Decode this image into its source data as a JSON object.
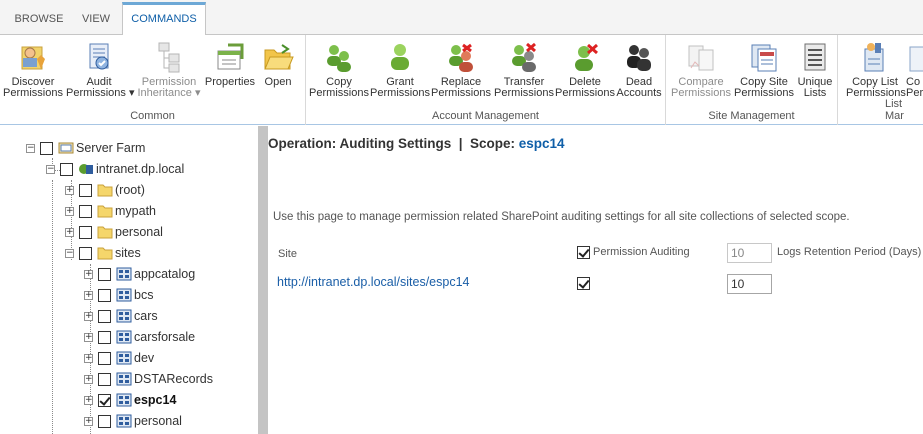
{
  "tabs": [
    {
      "label": "BROWSE"
    },
    {
      "label": "VIEW"
    },
    {
      "label": "COMMANDS"
    }
  ],
  "ribbon": {
    "groups": [
      {
        "label": "Common",
        "buttons": [
          {
            "l1": "Discover",
            "l2": "Permissions"
          },
          {
            "l1": "Audit",
            "l2": "Permissions ▾"
          },
          {
            "l1": "Permission",
            "l2": "Inheritance ▾"
          },
          {
            "l1": "Properties",
            "l2": ""
          },
          {
            "l1": "Open",
            "l2": ""
          }
        ]
      },
      {
        "label": "Account Management",
        "buttons": [
          {
            "l1": "Copy",
            "l2": "Permissions"
          },
          {
            "l1": "Grant",
            "l2": "Permissions"
          },
          {
            "l1": "Replace",
            "l2": "Permissions"
          },
          {
            "l1": "Transfer",
            "l2": "Permissions"
          },
          {
            "l1": "Delete",
            "l2": "Permissions"
          },
          {
            "l1": "Dead",
            "l2": "Accounts"
          }
        ]
      },
      {
        "label": "Site Management",
        "buttons": [
          {
            "l1": "Compare",
            "l2": "Permissions"
          },
          {
            "l1": "Copy Site",
            "l2": "Permissions"
          },
          {
            "l1": "Unique",
            "l2": "Lists"
          }
        ]
      },
      {
        "label": "List Mar",
        "buttons": [
          {
            "l1": "Copy List",
            "l2": "Permissions"
          },
          {
            "l1": "Co",
            "l2": "Per"
          }
        ]
      }
    ]
  },
  "tree": {
    "items": [
      {
        "label": "Server Farm",
        "checked": false
      },
      {
        "label": "intranet.dp.local",
        "checked": false
      },
      {
        "label": "(root)",
        "checked": false
      },
      {
        "label": "mypath",
        "checked": false
      },
      {
        "label": "personal",
        "checked": false
      },
      {
        "label": "sites",
        "checked": false
      },
      {
        "label": "appcatalog",
        "checked": false
      },
      {
        "label": "bcs",
        "checked": false
      },
      {
        "label": "cars",
        "checked": false
      },
      {
        "label": "carsforsale",
        "checked": false
      },
      {
        "label": "dev",
        "checked": false
      },
      {
        "label": "DSTARecords",
        "checked": false
      },
      {
        "label": "espc14",
        "checked": true
      },
      {
        "label": "personal",
        "checked": false
      }
    ]
  },
  "main": {
    "operation_prefix": "Operation: Auditing Settings  |  Scope: ",
    "scope_value": "espc14",
    "description": "Use this page to manage permission related SharePoint auditing settings for all site collections of selected scope.",
    "site_header": "Site",
    "permission_auditing_label": "Permission Auditing",
    "permission_auditing_checked": true,
    "retention_header_value": "10",
    "retention_label": "Logs Retention Period (Days)",
    "rows": [
      {
        "site_url": "http://intranet.dp.local/sites/espc14",
        "auditing": true,
        "retention": "10"
      }
    ]
  }
}
